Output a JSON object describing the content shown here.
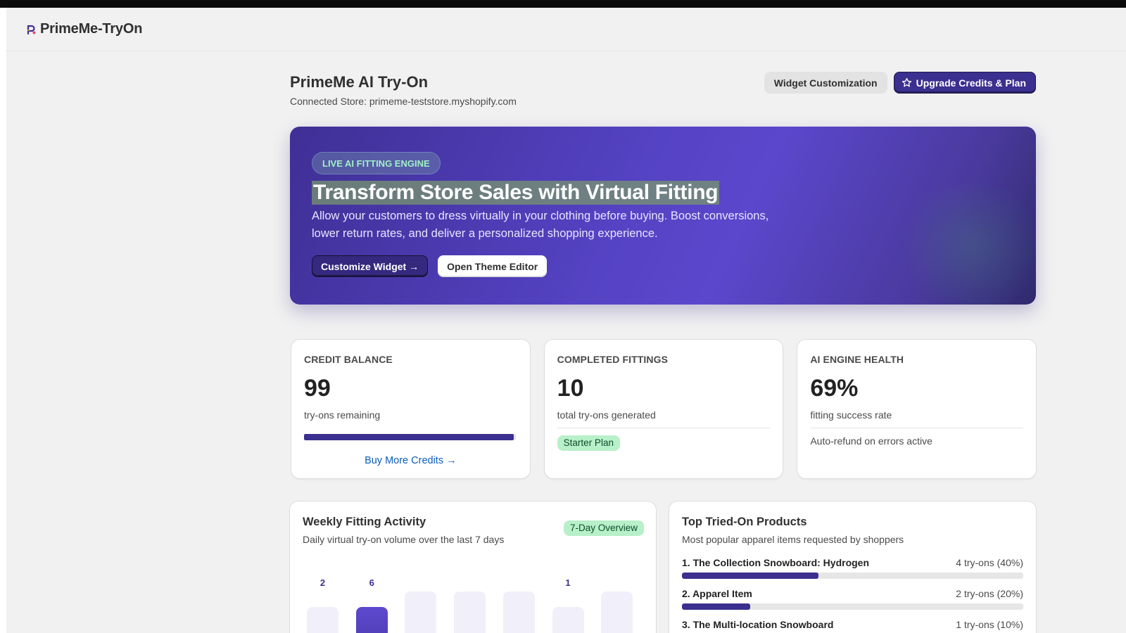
{
  "app": {
    "name": "PrimeMe-TryOn"
  },
  "header": {
    "title": "PrimeMe AI Try-On",
    "subtitle": "Connected Store: primeme-teststore.myshopify.com",
    "actions": {
      "widget_label": "Widget Customization",
      "upgrade_label": "Upgrade Credits & Plan"
    }
  },
  "hero": {
    "badge": "LIVE AI FITTING ENGINE",
    "title": "Transform Store Sales with Virtual Fitting",
    "description": "Allow your customers to dress virtually in your clothing before buying. Boost conversions, lower return rates, and deliver a personalized shopping experience.",
    "primary_label": "Customize Widget →",
    "secondary_label": "Open Theme Editor"
  },
  "stats": {
    "credit": {
      "label": "CREDIT BALANCE",
      "value": "99",
      "caption": "try-ons remaining",
      "progress": 0.99,
      "link": "Buy More Credits →"
    },
    "fittings": {
      "label": "COMPLETED FITTINGS",
      "value": "10",
      "caption": "total try-ons generated",
      "badge": "Starter Plan"
    },
    "health": {
      "label": "AI ENGINE HEALTH",
      "value": "69%",
      "caption": "fitting success rate",
      "note": "Auto-refund on errors active"
    }
  },
  "activity": {
    "title": "Weekly Fitting Activity",
    "subtitle": "Daily virtual try-on volume over the last 7 days",
    "badge": "7-Day Overview",
    "days": [
      {
        "count": "2",
        "value": 2,
        "active": false
      },
      {
        "count": "6",
        "value": 6,
        "active": true
      },
      {
        "count": "",
        "value": 0,
        "active": false
      },
      {
        "count": "",
        "value": 0,
        "active": false
      },
      {
        "count": "",
        "value": 0,
        "active": false
      },
      {
        "count": "1",
        "value": 1,
        "active": false
      },
      {
        "count": "",
        "value": 0,
        "active": false
      }
    ]
  },
  "products": {
    "title": "Top Tried-On Products",
    "subtitle": "Most popular apparel items requested by shoppers",
    "items": [
      {
        "name": "1. The Collection Snowboard: Hydrogen",
        "count": "4 try-ons (40%)",
        "share": 0.4
      },
      {
        "name": "2. Apparel Item",
        "count": "2 try-ons (20%)",
        "share": 0.2
      },
      {
        "name": "3. The Multi-location Snowboard",
        "count": "1 try-ons (10%)",
        "share": 0.1
      }
    ]
  },
  "colors": {
    "accent": "#3b2f8f",
    "hero": "#5443c3",
    "badge_green": "#b7f0c9",
    "link": "#0b5bbd"
  }
}
